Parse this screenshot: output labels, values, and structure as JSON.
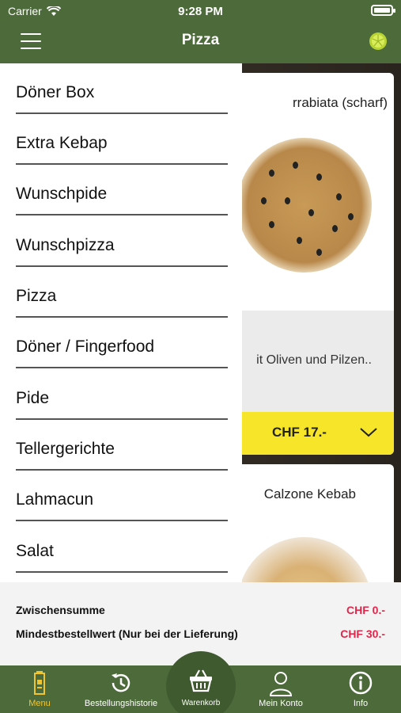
{
  "status": {
    "carrier": "Carrier",
    "time": "9:28 PM"
  },
  "header": {
    "title": "Pizza"
  },
  "menu": {
    "items": [
      "Döner Box",
      "Extra Kebap",
      "Wunschpide",
      "Wunschpizza",
      "Pizza",
      "Döner / Fingerfood",
      "Pide",
      "Tellergerichte",
      "Lahmacun",
      "Salat"
    ]
  },
  "products": [
    {
      "title": "rrabiata (scharf)",
      "description": "it Oliven und Pilzen..",
      "price": "CHF 17.-"
    },
    {
      "title": "Calzone Kebab"
    }
  ],
  "summary": {
    "subtotal_label": "Zwischensumme",
    "subtotal_value": "CHF 0.-",
    "min_order_label": "Mindestbestellwert (Nur bei der Lieferung)",
    "min_order_value": "CHF 30.-"
  },
  "tabs": {
    "menu": "Menu",
    "history": "Bestellungshistorie",
    "cart": "Warenkorb",
    "account": "Mein Konto",
    "info": "Info"
  },
  "colors": {
    "brand_green": "#4d6b3a",
    "price_yellow": "#f7e52a",
    "accent_red": "#e2264a",
    "active_tab": "#f0c533"
  }
}
